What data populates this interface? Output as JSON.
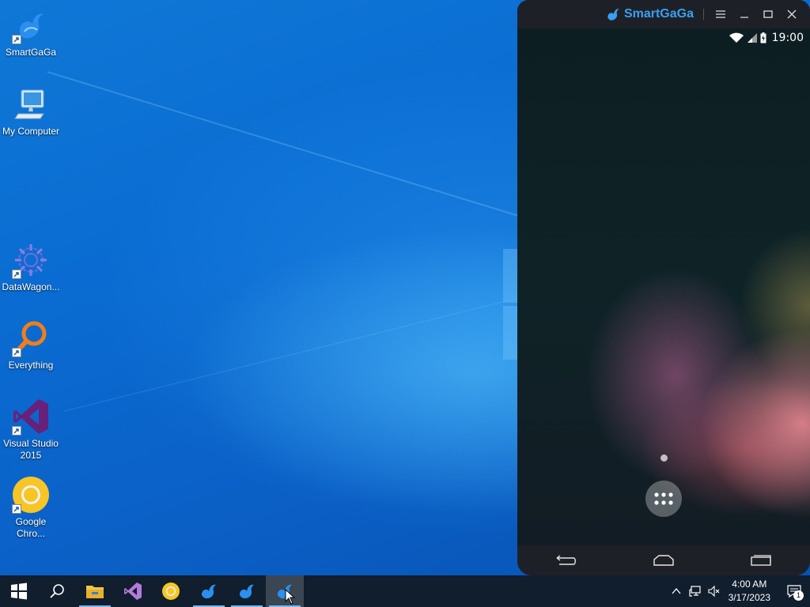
{
  "desktop": {
    "icons": [
      {
        "label": "SmartGaGa",
        "icon": "smartgaga-swan-icon"
      },
      {
        "label": "My Computer",
        "icon": "computer-icon"
      },
      {
        "label": "DataWagon...",
        "icon": "datawagon-icon"
      },
      {
        "label": "Everything",
        "icon": "everything-search-icon"
      },
      {
        "label": "Visual Studio 2015",
        "icon": "visual-studio-icon"
      },
      {
        "label": "Google Chro...",
        "icon": "chrome-icon"
      }
    ]
  },
  "emulator": {
    "brand": "SmartGaGa",
    "status_time": "19:00",
    "colors": {
      "titlebar": "#1d2127",
      "brand": "#3aa0f0"
    }
  },
  "taskbar": {
    "items": [
      "windows-start-icon",
      "search-icon",
      "file-explorer-icon",
      "visual-studio-icon",
      "chrome-icon",
      "smartgaga-icon",
      "smartgaga-icon",
      "smartgaga-icon"
    ],
    "clock_time": "4:00 AM",
    "clock_date": "3/17/2023",
    "notification_count": "1",
    "accent": "#76b9ed"
  }
}
